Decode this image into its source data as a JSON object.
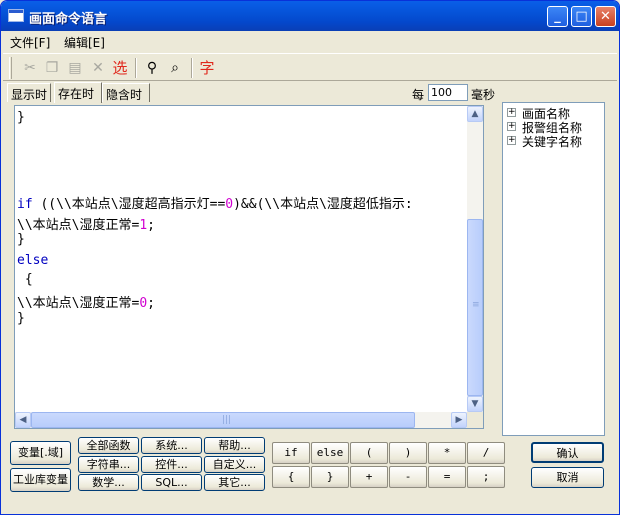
{
  "window": {
    "title": "画面命令语言"
  },
  "title_buttons": {
    "minimize": "_",
    "maximize": "□",
    "close": "✕"
  },
  "menu": [
    "文件[F]",
    "编辑[E]"
  ],
  "toolbar": {
    "icons": [
      "cut-icon",
      "copy-icon",
      "paste-icon",
      "delete-icon",
      "select-icon",
      "find-icon",
      "replace-icon",
      "font-icon"
    ],
    "select_label": "选",
    "font_label": "字",
    "red_color": "#e0281c"
  },
  "tabs": [
    "显示时",
    "存在时",
    "隐含时"
  ],
  "active_tab": "存在时",
  "rate": {
    "prefix": "每",
    "value": "100",
    "unit": "毫秒"
  },
  "code": {
    "line1": "}",
    "if_kw": "if",
    "if_a": " ((\\\\本站点\\湿度超高指示灯==",
    "if_a_num": "0",
    "if_b": ")&&(\\\\本站点\\湿度超低指示:",
    "assign1": "\\\\本站点\\湿度正常=",
    "assign1_num": "1",
    "assign1_end": ";",
    "close1": "}",
    "else_kw": "else",
    "open2": " {",
    "assign2": "\\\\本站点\\湿度正常=",
    "assign2_num": "0",
    "assign2_end": ";",
    "close2": "}"
  },
  "tree": [
    "画面名称",
    "报警组名称",
    "关键字名称"
  ],
  "buttons": {
    "variable": "变量[.域]",
    "industry_lib": "工业库变量",
    "all_functions": "全部函数",
    "system": "系统...",
    "help": "帮助...",
    "string": "字符串...",
    "control": "控件...",
    "custom": "自定义...",
    "math": "数学...",
    "sql": "SQL...",
    "other": "其它...",
    "ops_row1": [
      "if",
      "else",
      "(",
      ")",
      "*",
      "/"
    ],
    "ops_row2": [
      "{",
      "}",
      "+",
      "-",
      "=",
      ";"
    ],
    "confirm": "确认",
    "cancel": "取消"
  }
}
